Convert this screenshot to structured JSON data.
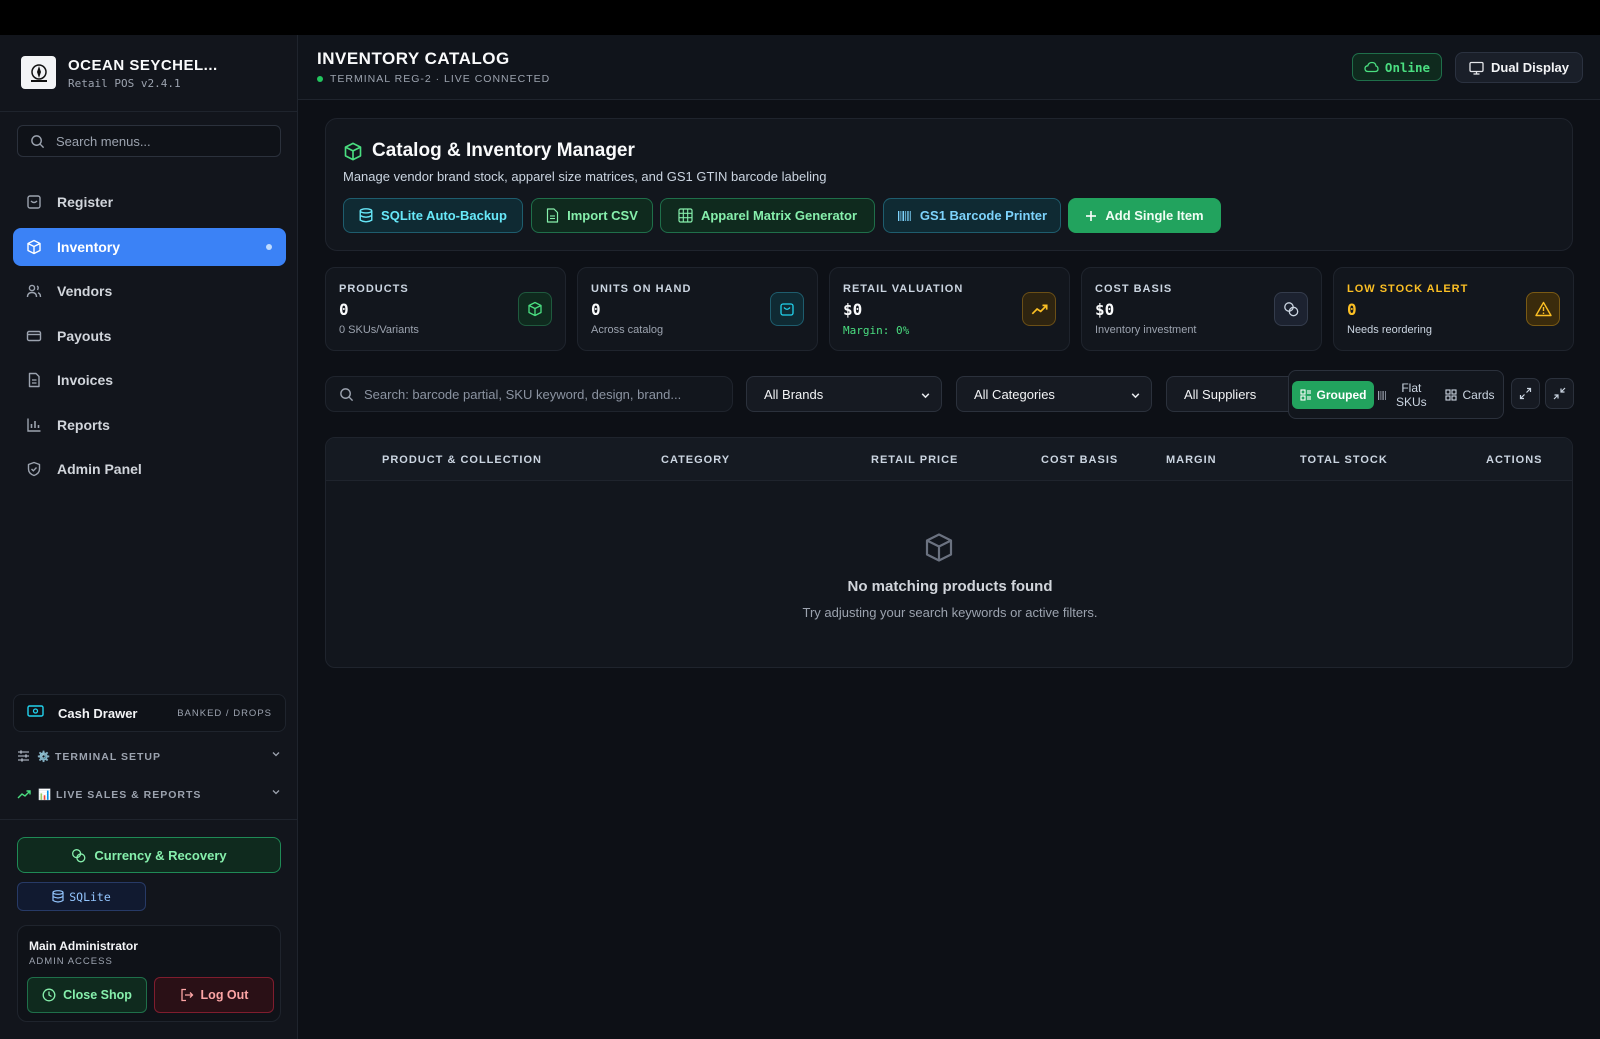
{
  "app": {
    "name": "OCEAN SEYCHEL...",
    "version": "Retail POS v2.4.1"
  },
  "sidebar": {
    "search_placeholder": "Search menus...",
    "items": [
      {
        "label": "Register",
        "icon": "register-icon",
        "active": false
      },
      {
        "label": "Inventory",
        "icon": "box-icon",
        "active": true
      },
      {
        "label": "Vendors",
        "icon": "users-icon",
        "active": false
      },
      {
        "label": "Payouts",
        "icon": "card-icon",
        "active": false
      },
      {
        "label": "Invoices",
        "icon": "document-icon",
        "active": false
      },
      {
        "label": "Reports",
        "icon": "bar-chart-icon",
        "active": false
      },
      {
        "label": "Admin Panel",
        "icon": "shield-icon",
        "active": false
      }
    ],
    "cash_drawer": {
      "label": "Cash Drawer",
      "tag": "BANKED / DROPS"
    },
    "sections": [
      {
        "label": "⚙️ TERMINAL SETUP"
      },
      {
        "label": "📊 LIVE SALES & REPORTS"
      }
    ],
    "currency_button": "Currency & Recovery",
    "db_badge": "SQLite",
    "user": {
      "name": "Main Administrator",
      "role": "ADMIN ACCESS",
      "close_shop": "Close Shop",
      "logout": "Log Out"
    }
  },
  "header": {
    "title": "INVENTORY CATALOG",
    "subtitle": "TERMINAL REG-2 · LIVE CONNECTED",
    "status": "Online",
    "dual_display": "Dual Display"
  },
  "catalog": {
    "title": "Catalog & Inventory Manager",
    "description": "Manage vendor brand stock, apparel size matrices, and GS1 GTIN barcode labeling",
    "actions": {
      "backup": "SQLite Auto-Backup",
      "import": "Import CSV",
      "matrix": "Apparel Matrix Generator",
      "barcode": "GS1 Barcode Printer",
      "add": "Add Single Item"
    }
  },
  "stats": [
    {
      "label": "PRODUCTS",
      "value": "0",
      "note": "0 SKUs/Variants",
      "icon": "box-icon",
      "label_color": "#cbd5e1",
      "value_color": "#f9fafb",
      "note_color": "#9ca3af"
    },
    {
      "label": "UNITS ON HAND",
      "value": "0",
      "note": "Across catalog",
      "icon": "bag-icon",
      "label_color": "#cbd5e1",
      "value_color": "#4ade80",
      "note_color": "#9ca3af"
    },
    {
      "label": "RETAIL VALUATION",
      "value": "$0",
      "note": "Margin: 0%",
      "icon": "trend-up-icon",
      "label_color": "#cbd5e1",
      "value_color": "#f9fafb",
      "note_color": "#4ade80"
    },
    {
      "label": "COST BASIS",
      "value": "$0",
      "note": "Inventory investment",
      "icon": "coins-icon",
      "label_color": "#cbd5e1",
      "value_color": "#f9fafb",
      "note_color": "#9ca3af"
    },
    {
      "label": "LOW STOCK ALERT",
      "value": "0",
      "note": "Needs reordering",
      "icon": "warning-icon",
      "label_color": "#fbbf24",
      "value_color": "#fbbf24",
      "note_color": "#cbd5e1"
    }
  ],
  "filters": {
    "search_placeholder": "Search: barcode partial, SKU keyword, design, brand...",
    "brand": "All Brands",
    "category": "All Categories",
    "supplier": "All Suppliers",
    "views": {
      "grouped": "Grouped",
      "flat_line1": "Flat",
      "flat_line2": "SKUs",
      "cards": "Cards"
    }
  },
  "table": {
    "columns": [
      "PRODUCT & COLLECTION",
      "CATEGORY",
      "RETAIL PRICE",
      "COST BASIS",
      "MARGIN",
      "TOTAL STOCK",
      "ACTIONS"
    ],
    "empty_title": "No matching products found",
    "empty_subtitle": "Try adjusting your search keywords or active filters."
  },
  "colors": {
    "accent_blue": "#3b82f6",
    "accent_green": "#22a35e",
    "warning": "#fbbf24",
    "background": "#0d1016"
  }
}
